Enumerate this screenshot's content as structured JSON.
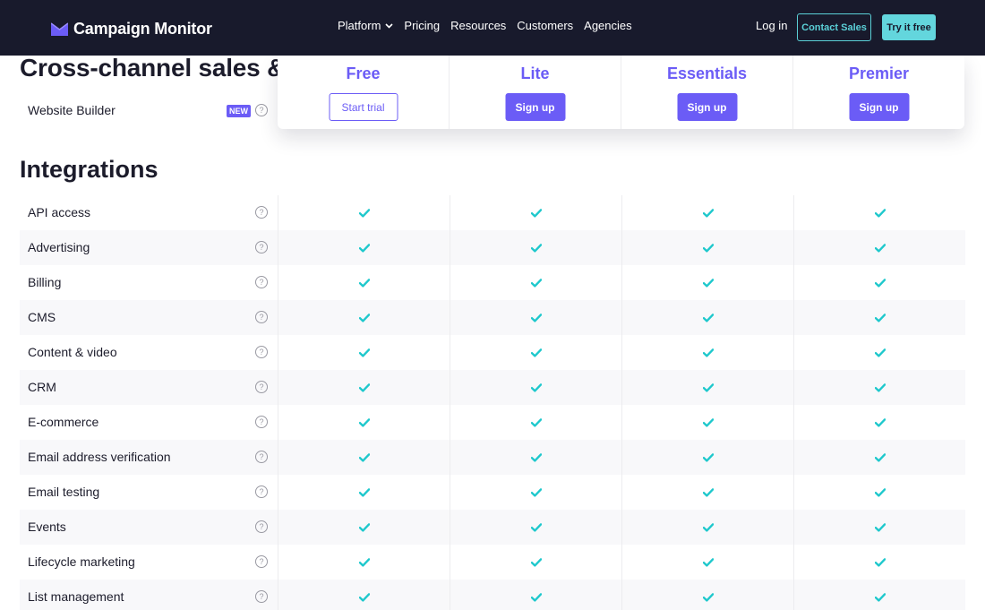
{
  "nav": {
    "logo_text": "Campaign Monitor",
    "links": [
      "Platform",
      "Pricing",
      "Resources",
      "Customers",
      "Agencies"
    ],
    "login_label": "Log in",
    "contact_label": "Contact Sales",
    "try_label": "Try it free"
  },
  "prev_section": {
    "title_partial": "Cross-channel sales &",
    "row_label": "Website Builder",
    "badge": "NEW"
  },
  "plans": [
    {
      "name": "Free",
      "button": "Start trial",
      "style": "outline"
    },
    {
      "name": "Lite",
      "button": "Sign up",
      "style": "solid"
    },
    {
      "name": "Essentials",
      "button": "Sign up",
      "style": "solid"
    },
    {
      "name": "Premier",
      "button": "Sign up",
      "style": "solid"
    }
  ],
  "integrations": {
    "title": "Integrations",
    "help_glyph": "?",
    "rows": [
      {
        "label": "API access",
        "checks": [
          true,
          true,
          true,
          true
        ]
      },
      {
        "label": "Advertising",
        "checks": [
          true,
          true,
          true,
          true
        ]
      },
      {
        "label": "Billing",
        "checks": [
          true,
          true,
          true,
          true
        ]
      },
      {
        "label": "CMS",
        "checks": [
          true,
          true,
          true,
          true
        ]
      },
      {
        "label": "Content & video",
        "checks": [
          true,
          true,
          true,
          true
        ]
      },
      {
        "label": "CRM",
        "checks": [
          true,
          true,
          true,
          true
        ]
      },
      {
        "label": "E-commerce",
        "checks": [
          true,
          true,
          true,
          true
        ]
      },
      {
        "label": "Email address verification",
        "checks": [
          true,
          true,
          true,
          true
        ]
      },
      {
        "label": "Email testing",
        "checks": [
          true,
          true,
          true,
          true
        ]
      },
      {
        "label": "Events",
        "checks": [
          true,
          true,
          true,
          true
        ]
      },
      {
        "label": "Lifecycle marketing",
        "checks": [
          true,
          true,
          true,
          true
        ]
      },
      {
        "label": "List management",
        "checks": [
          true,
          true,
          true,
          true
        ]
      }
    ]
  },
  "colors": {
    "brand_purple": "#6b5cf6",
    "check_teal": "#1ec8cc",
    "nav_bg": "#181a2c",
    "accent_teal": "#63d6dd"
  }
}
